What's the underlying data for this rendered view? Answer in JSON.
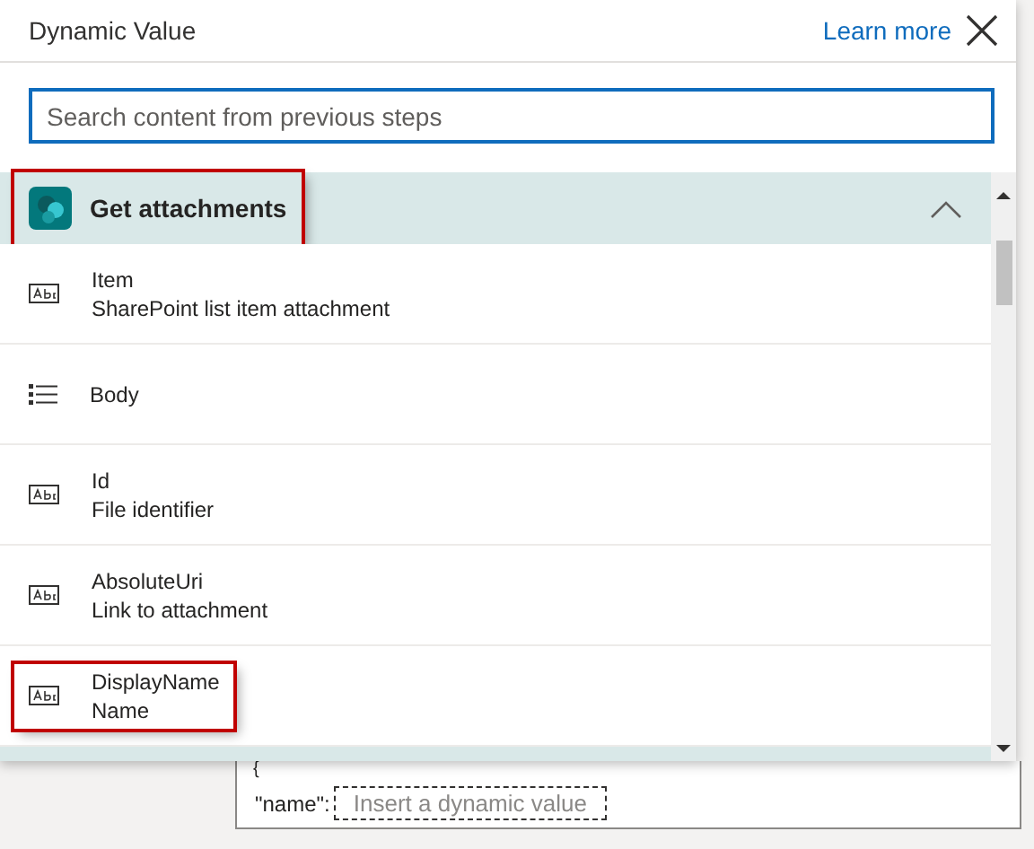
{
  "panel": {
    "title": "Dynamic Value",
    "learn_more": "Learn more",
    "search": {
      "placeholder": "Search content from previous steps"
    }
  },
  "group": {
    "title": "Get attachments",
    "expanded": true,
    "highlighted": true
  },
  "items": [
    {
      "kind": "text",
      "name": "Item",
      "description": "SharePoint list item attachment",
      "highlighted": false
    },
    {
      "kind": "list",
      "name": "Body",
      "highlighted": false
    },
    {
      "kind": "text",
      "name": "Id",
      "description": "File identifier",
      "highlighted": false
    },
    {
      "kind": "text",
      "name": "AbsoluteUri",
      "description": "Link to attachment",
      "highlighted": false
    },
    {
      "kind": "text",
      "name": "DisplayName",
      "description": "Name",
      "highlighted": true
    }
  ],
  "editor": {
    "brace": "{",
    "key": "\"name\":",
    "placeholder": "Insert a dynamic value"
  }
}
